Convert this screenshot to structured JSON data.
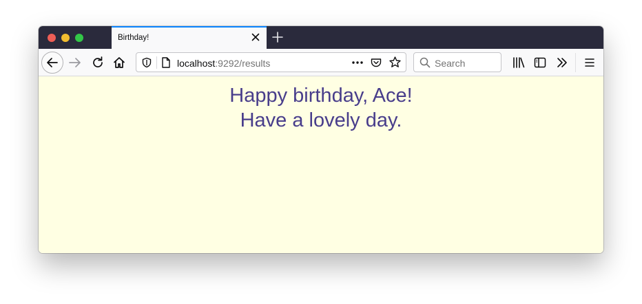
{
  "window": {
    "traffic_lights": [
      "close",
      "minimize",
      "maximize"
    ]
  },
  "tab": {
    "title": "Birthday!",
    "icons": {
      "close": "close-icon",
      "new_tab": "plus-icon"
    }
  },
  "navbar": {
    "icons": [
      "back-arrow-icon",
      "forward-arrow-icon",
      "reload-icon",
      "home-icon",
      "shield-icon",
      "page-icon",
      "more-icon",
      "pocket-icon",
      "star-icon",
      "search-icon",
      "library-icon",
      "sidebar-icon",
      "overflow-chevron-icon",
      "hamburger-menu-icon"
    ],
    "url": {
      "host": "localhost",
      "path": ":9292/results"
    },
    "search": {
      "placeholder": "Search"
    }
  },
  "page": {
    "line1": "Happy birthday, Ace!",
    "line2": "Have a lovely day.",
    "background": "#ffffe3",
    "text_color": "#483d8b"
  }
}
